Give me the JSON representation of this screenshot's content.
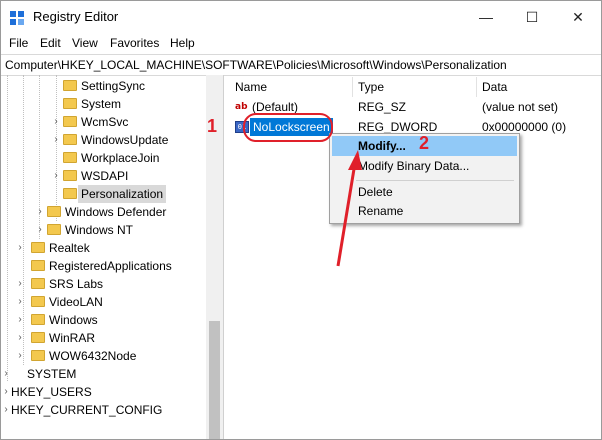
{
  "window": {
    "title": "Registry Editor",
    "minimize_glyph": "—",
    "maximize_glyph": "☐",
    "close_glyph": "✕"
  },
  "menu": [
    "File",
    "Edit",
    "View",
    "Favorites",
    "Help"
  ],
  "address": "Computer\\HKEY_LOCAL_MACHINE\\SOFTWARE\\Policies\\Microsoft\\Windows\\Personalization",
  "tree": {
    "items": [
      {
        "label": "SettingSync",
        "expander": "",
        "selected": false
      },
      {
        "label": "System",
        "expander": "",
        "selected": false
      },
      {
        "label": "WcmSvc",
        "expander": "›",
        "selected": false
      },
      {
        "label": "WindowsUpdate",
        "expander": "›",
        "selected": false
      },
      {
        "label": "WorkplaceJoin",
        "expander": "",
        "selected": false
      },
      {
        "label": "WSDAPI",
        "expander": "›",
        "selected": false
      },
      {
        "label": "Personalization",
        "expander": "",
        "selected": true
      },
      {
        "label": "Windows Defender",
        "expander": "›",
        "selected": false
      },
      {
        "label": "Windows NT",
        "expander": "›",
        "selected": false
      },
      {
        "label": "Realtek",
        "expander": "›",
        "selected": false
      },
      {
        "label": "RegisteredApplications",
        "expander": "",
        "selected": false
      },
      {
        "label": "SRS Labs",
        "expander": "›",
        "selected": false
      },
      {
        "label": "VideoLAN",
        "expander": "›",
        "selected": false
      },
      {
        "label": "Windows",
        "expander": "›",
        "selected": false
      },
      {
        "label": "WinRAR",
        "expander": "›",
        "selected": false
      },
      {
        "label": "WOW6432Node",
        "expander": "›",
        "selected": false
      },
      {
        "label": "SYSTEM",
        "expander": "›",
        "selected": false
      },
      {
        "label": "HKEY_USERS",
        "expander": "›",
        "selected": false
      },
      {
        "label": "HKEY_CURRENT_CONFIG",
        "expander": "›",
        "selected": false
      }
    ]
  },
  "values": {
    "columns": [
      "Name",
      "Type",
      "Data"
    ],
    "rows": [
      {
        "name": "(Default)",
        "type": "REG_SZ",
        "data": "(value not set)",
        "icon": "string-value-icon"
      },
      {
        "name": "NoLockscreen",
        "type": "REG_DWORD",
        "data": "0x00000000 (0)",
        "icon": "binary-value-icon"
      }
    ]
  },
  "context_menu": {
    "items": [
      "Modify...",
      "Modify Binary Data...",
      "Delete",
      "Rename"
    ]
  },
  "annotations": {
    "step1": "1",
    "step2": "2",
    "color": "#e0202a"
  },
  "colors": {
    "selection": "#0078d7",
    "menu_highlight": "#91c9f7",
    "folder": "#f3c84e"
  }
}
